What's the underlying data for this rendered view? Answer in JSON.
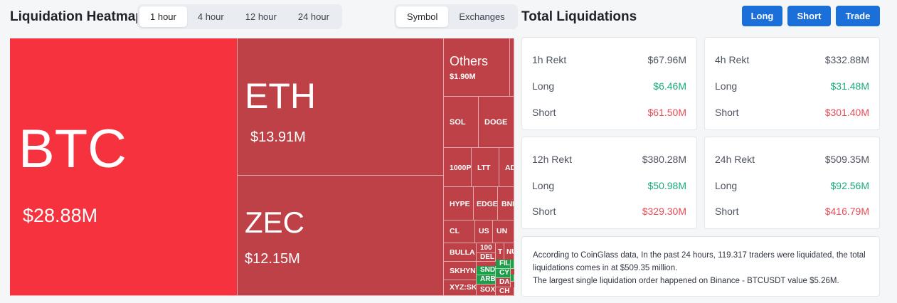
{
  "heatmap": {
    "title": "Liquidation Heatmap",
    "time_tabs": [
      "1 hour",
      "4 hour",
      "12 hour",
      "24 hour"
    ],
    "active_time_tab": "1 hour",
    "view_tabs": [
      "Symbol",
      "Exchanges"
    ],
    "active_view_tab": "Symbol",
    "cells": [
      {
        "symbol": "BTC",
        "value": "$28.88M"
      },
      {
        "symbol": "ETH",
        "value": "$13.91M"
      },
      {
        "symbol": "ZEC",
        "value": "$12.15M"
      },
      {
        "symbol": "Others",
        "value": "$1.90M"
      },
      {
        "symbol": "SOL"
      },
      {
        "symbol": "DOGE"
      },
      {
        "symbol": "1000P"
      },
      {
        "symbol": "LTT"
      },
      {
        "symbol": "AD"
      },
      {
        "symbol": "HYPE"
      },
      {
        "symbol": "EDGE"
      },
      {
        "symbol": "BNB"
      },
      {
        "symbol": "CL"
      },
      {
        "symbol": "US"
      },
      {
        "symbol": "UN"
      },
      {
        "symbol": "BULLA"
      },
      {
        "symbol": "100"
      },
      {
        "symbol": "DEL"
      },
      {
        "symbol": "T"
      },
      {
        "symbol": "NU"
      },
      {
        "symbol": "SKHYN"
      },
      {
        "symbol": "SND"
      },
      {
        "symbol": "FIL"
      },
      {
        "symbol": "CY"
      },
      {
        "symbol": "ARB"
      },
      {
        "symbol": "DA"
      },
      {
        "symbol": "XYZ:SK"
      },
      {
        "symbol": "SOX"
      },
      {
        "symbol": "CH"
      }
    ]
  },
  "totals": {
    "title": "Total Liquidations",
    "buttons": {
      "long": "Long",
      "short": "Short",
      "trade": "Trade"
    },
    "cards": [
      {
        "label": "1h Rekt",
        "total": "$67.96M",
        "long_label": "Long",
        "long": "$6.46M",
        "short_label": "Short",
        "short": "$61.50M"
      },
      {
        "label": "4h Rekt",
        "total": "$332.88M",
        "long_label": "Long",
        "long": "$31.48M",
        "short_label": "Short",
        "short": "$301.40M"
      },
      {
        "label": "12h Rekt",
        "total": "$380.28M",
        "long_label": "Long",
        "long": "$50.98M",
        "short_label": "Short",
        "short": "$329.30M"
      },
      {
        "label": "24h Rekt",
        "total": "$509.35M",
        "long_label": "Long",
        "long": "$92.56M",
        "short_label": "Short",
        "short": "$416.79M"
      }
    ],
    "summary_line1": "According to CoinGlass data, In the past 24 hours, 119.317 traders were liquidated, the total liquidations comes in at $509.35 million.",
    "summary_line2": "The largest single liquidation order happened on Binance - BTCUSDT value $5.26M."
  },
  "colors": {
    "accent": "#1a6fd8",
    "heatmap_red_bright": "#f5323e",
    "heatmap_red": "#bd4147",
    "heatmap_green": "#1f9e4a",
    "positive": "#1aab7e",
    "negative": "#e94b56"
  }
}
